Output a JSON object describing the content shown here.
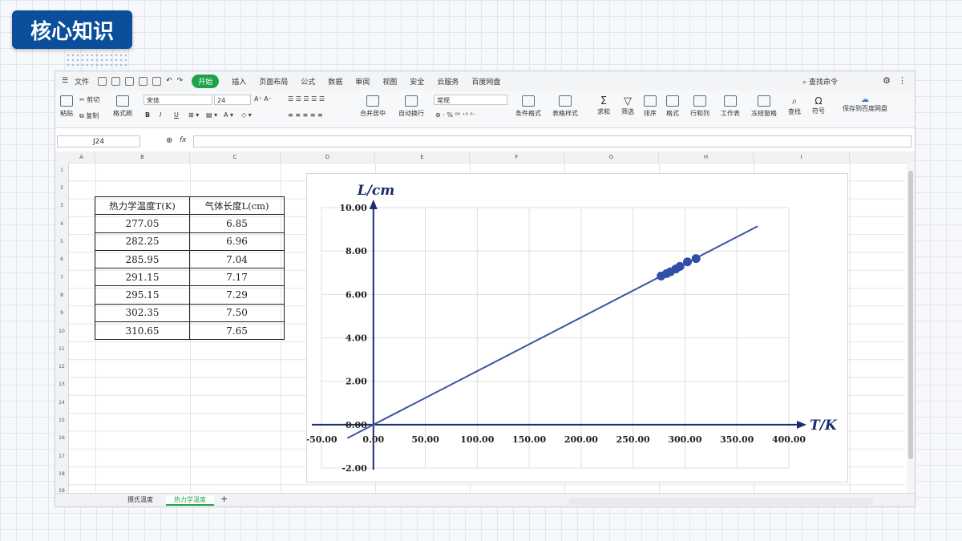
{
  "slide": {
    "title": "核心知识"
  },
  "menu": {
    "file": "文件",
    "items": [
      "开始",
      "插入",
      "页面布局",
      "公式",
      "数据",
      "审阅",
      "视图",
      "安全",
      "云服务",
      "百度网盘"
    ],
    "search": "查找命令"
  },
  "ribbon": {
    "cut": "剪切",
    "paste": "粘贴",
    "copy": "复制",
    "format_painter": "格式刷",
    "font": "宋体",
    "font_size": "24",
    "number_format": "常规",
    "merge": "合并居中",
    "wrap": "自动换行",
    "cond_format": "条件格式",
    "table_style": "表格样式",
    "sum": "求和",
    "filter": "筛选",
    "sort": "排序",
    "format": "格式",
    "rowcol": "行和列",
    "sheet": "工作表",
    "freeze": "冻结窗格",
    "find": "查找",
    "symbol": "符号",
    "save_baidu": "保存到百度网盘"
  },
  "formula_bar": {
    "cell_ref": "J24",
    "fx": "fx"
  },
  "columns": [
    "A",
    "B",
    "C",
    "D",
    "E",
    "F",
    "G",
    "H",
    "I"
  ],
  "rows": [
    "1",
    "2",
    "3",
    "4",
    "5",
    "6",
    "7",
    "8",
    "9",
    "10",
    "11",
    "12",
    "13",
    "14",
    "15",
    "16",
    "17",
    "18",
    "19"
  ],
  "table": {
    "headers": [
      "热力学温度T(K)",
      "气体长度L(cm)"
    ],
    "rows": [
      [
        "277.05",
        "6.85"
      ],
      [
        "282.25",
        "6.96"
      ],
      [
        "285.95",
        "7.04"
      ],
      [
        "291.15",
        "7.17"
      ],
      [
        "295.15",
        "7.29"
      ],
      [
        "302.35",
        "7.50"
      ],
      [
        "310.65",
        "7.65"
      ]
    ]
  },
  "sheets": {
    "tab1": "摄氏温度",
    "tab2": "热力学温度",
    "add": "+"
  },
  "chart_data": {
    "type": "scatter",
    "xlabel": "T/K",
    "ylabel": "L/cm",
    "xlim": [
      -50,
      400
    ],
    "ylim": [
      -2,
      10
    ],
    "xticks": [
      "-50.00",
      "0.00",
      "50.00",
      "100.00",
      "150.00",
      "200.00",
      "250.00",
      "300.00",
      "350.00",
      "400.00"
    ],
    "yticks": [
      "-2.00",
      "0.00",
      "2.00",
      "4.00",
      "6.00",
      "8.00",
      "10.00"
    ],
    "grid": true,
    "points": {
      "x": [
        277.05,
        282.25,
        285.95,
        291.15,
        295.15,
        302.35,
        310.65
      ],
      "y": [
        6.85,
        6.96,
        7.04,
        7.17,
        7.29,
        7.5,
        7.65
      ]
    },
    "trendline": {
      "x": [
        -25,
        370
      ],
      "y": [
        -0.62,
        9.14
      ]
    },
    "colors": {
      "points": "#2f4fa8",
      "line": "#3a55a0",
      "axis": "#1a2c6b"
    }
  }
}
